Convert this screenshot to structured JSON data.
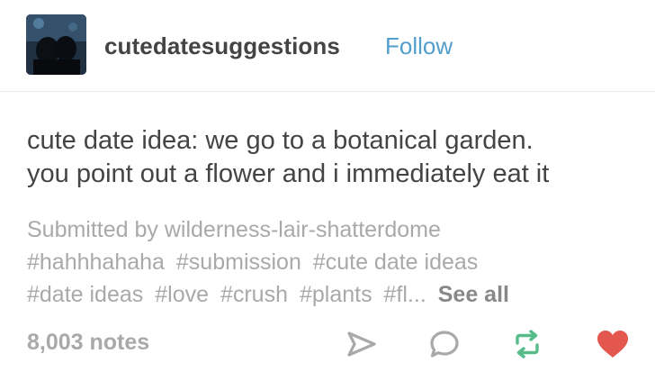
{
  "header": {
    "blog_name": "cutedatesuggestions",
    "follow_label": "Follow"
  },
  "post": {
    "text_lines": [
      "cute date idea: we go to a botanical garden.",
      "you point out a flower and i immediately eat it"
    ],
    "submitted_by": "Submitted by wilderness-lair-shatterdome",
    "tags": [
      "#hahhhahaha",
      "#submission",
      "#cute date ideas",
      "#date ideas",
      "#love",
      "#crush",
      "#plants",
      "#fl..."
    ],
    "see_all_label": "See all"
  },
  "footer": {
    "notes": "8,003 notes",
    "icons": [
      "share-icon",
      "reply-icon",
      "reblog-icon",
      "like-icon"
    ]
  },
  "colors": {
    "follow": "#529ecc",
    "reblog": "#56bc8a",
    "like": "#e4574f",
    "muted": "#a9a9a9",
    "text": "#444444"
  }
}
